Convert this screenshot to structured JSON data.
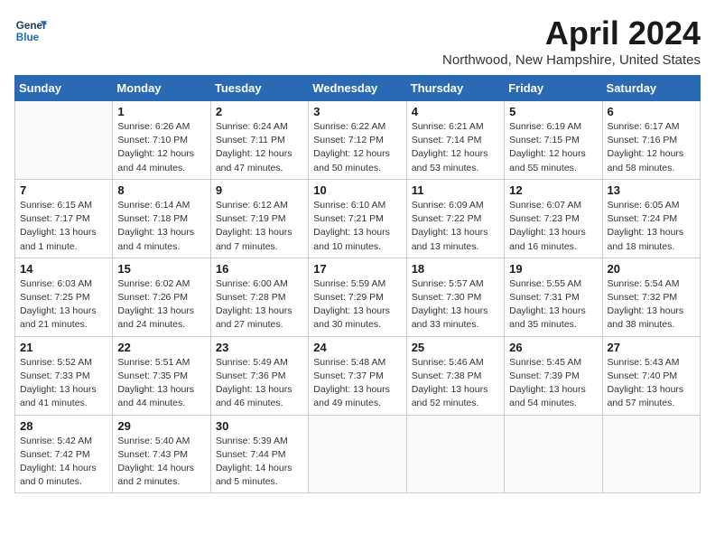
{
  "logo": {
    "line1": "General",
    "line2": "Blue"
  },
  "title": "April 2024",
  "location": "Northwood, New Hampshire, United States",
  "weekdays": [
    "Sunday",
    "Monday",
    "Tuesday",
    "Wednesday",
    "Thursday",
    "Friday",
    "Saturday"
  ],
  "weeks": [
    [
      {
        "day": "",
        "info": ""
      },
      {
        "day": "1",
        "info": "Sunrise: 6:26 AM\nSunset: 7:10 PM\nDaylight: 12 hours\nand 44 minutes."
      },
      {
        "day": "2",
        "info": "Sunrise: 6:24 AM\nSunset: 7:11 PM\nDaylight: 12 hours\nand 47 minutes."
      },
      {
        "day": "3",
        "info": "Sunrise: 6:22 AM\nSunset: 7:12 PM\nDaylight: 12 hours\nand 50 minutes."
      },
      {
        "day": "4",
        "info": "Sunrise: 6:21 AM\nSunset: 7:14 PM\nDaylight: 12 hours\nand 53 minutes."
      },
      {
        "day": "5",
        "info": "Sunrise: 6:19 AM\nSunset: 7:15 PM\nDaylight: 12 hours\nand 55 minutes."
      },
      {
        "day": "6",
        "info": "Sunrise: 6:17 AM\nSunset: 7:16 PM\nDaylight: 12 hours\nand 58 minutes."
      }
    ],
    [
      {
        "day": "7",
        "info": "Sunrise: 6:15 AM\nSunset: 7:17 PM\nDaylight: 13 hours\nand 1 minute."
      },
      {
        "day": "8",
        "info": "Sunrise: 6:14 AM\nSunset: 7:18 PM\nDaylight: 13 hours\nand 4 minutes."
      },
      {
        "day": "9",
        "info": "Sunrise: 6:12 AM\nSunset: 7:19 PM\nDaylight: 13 hours\nand 7 minutes."
      },
      {
        "day": "10",
        "info": "Sunrise: 6:10 AM\nSunset: 7:21 PM\nDaylight: 13 hours\nand 10 minutes."
      },
      {
        "day": "11",
        "info": "Sunrise: 6:09 AM\nSunset: 7:22 PM\nDaylight: 13 hours\nand 13 minutes."
      },
      {
        "day": "12",
        "info": "Sunrise: 6:07 AM\nSunset: 7:23 PM\nDaylight: 13 hours\nand 16 minutes."
      },
      {
        "day": "13",
        "info": "Sunrise: 6:05 AM\nSunset: 7:24 PM\nDaylight: 13 hours\nand 18 minutes."
      }
    ],
    [
      {
        "day": "14",
        "info": "Sunrise: 6:03 AM\nSunset: 7:25 PM\nDaylight: 13 hours\nand 21 minutes."
      },
      {
        "day": "15",
        "info": "Sunrise: 6:02 AM\nSunset: 7:26 PM\nDaylight: 13 hours\nand 24 minutes."
      },
      {
        "day": "16",
        "info": "Sunrise: 6:00 AM\nSunset: 7:28 PM\nDaylight: 13 hours\nand 27 minutes."
      },
      {
        "day": "17",
        "info": "Sunrise: 5:59 AM\nSunset: 7:29 PM\nDaylight: 13 hours\nand 30 minutes."
      },
      {
        "day": "18",
        "info": "Sunrise: 5:57 AM\nSunset: 7:30 PM\nDaylight: 13 hours\nand 33 minutes."
      },
      {
        "day": "19",
        "info": "Sunrise: 5:55 AM\nSunset: 7:31 PM\nDaylight: 13 hours\nand 35 minutes."
      },
      {
        "day": "20",
        "info": "Sunrise: 5:54 AM\nSunset: 7:32 PM\nDaylight: 13 hours\nand 38 minutes."
      }
    ],
    [
      {
        "day": "21",
        "info": "Sunrise: 5:52 AM\nSunset: 7:33 PM\nDaylight: 13 hours\nand 41 minutes."
      },
      {
        "day": "22",
        "info": "Sunrise: 5:51 AM\nSunset: 7:35 PM\nDaylight: 13 hours\nand 44 minutes."
      },
      {
        "day": "23",
        "info": "Sunrise: 5:49 AM\nSunset: 7:36 PM\nDaylight: 13 hours\nand 46 minutes."
      },
      {
        "day": "24",
        "info": "Sunrise: 5:48 AM\nSunset: 7:37 PM\nDaylight: 13 hours\nand 49 minutes."
      },
      {
        "day": "25",
        "info": "Sunrise: 5:46 AM\nSunset: 7:38 PM\nDaylight: 13 hours\nand 52 minutes."
      },
      {
        "day": "26",
        "info": "Sunrise: 5:45 AM\nSunset: 7:39 PM\nDaylight: 13 hours\nand 54 minutes."
      },
      {
        "day": "27",
        "info": "Sunrise: 5:43 AM\nSunset: 7:40 PM\nDaylight: 13 hours\nand 57 minutes."
      }
    ],
    [
      {
        "day": "28",
        "info": "Sunrise: 5:42 AM\nSunset: 7:42 PM\nDaylight: 14 hours\nand 0 minutes."
      },
      {
        "day": "29",
        "info": "Sunrise: 5:40 AM\nSunset: 7:43 PM\nDaylight: 14 hours\nand 2 minutes."
      },
      {
        "day": "30",
        "info": "Sunrise: 5:39 AM\nSunset: 7:44 PM\nDaylight: 14 hours\nand 5 minutes."
      },
      {
        "day": "",
        "info": ""
      },
      {
        "day": "",
        "info": ""
      },
      {
        "day": "",
        "info": ""
      },
      {
        "day": "",
        "info": ""
      }
    ]
  ]
}
